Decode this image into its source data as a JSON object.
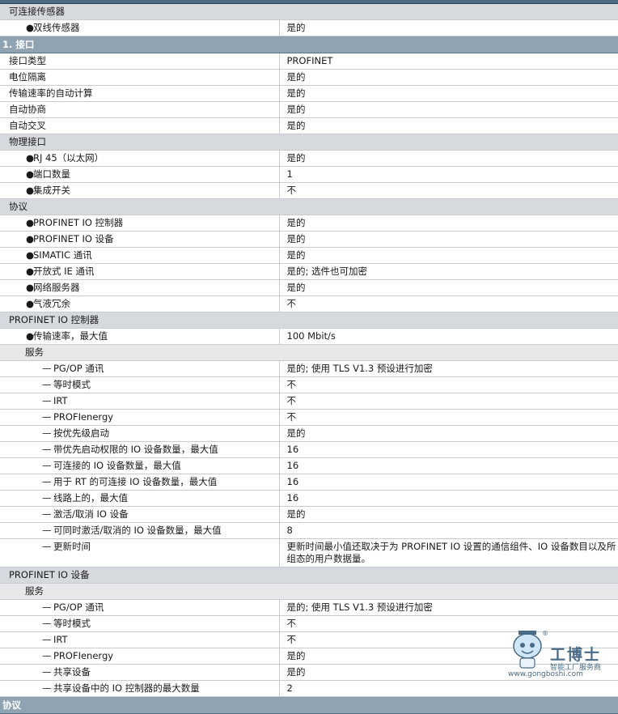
{
  "rows": [
    {
      "kind": "grp",
      "label": "可连接传感器",
      "value": ""
    },
    {
      "kind": "row",
      "level": 1,
      "marker": "bullet",
      "label": "双线传感器",
      "value": "是的"
    },
    {
      "kind": "sec",
      "label": "1. 接口"
    },
    {
      "kind": "row",
      "level": 0,
      "marker": "",
      "label": "接口类型",
      "value": "PROFINET"
    },
    {
      "kind": "row",
      "level": 0,
      "marker": "",
      "label": "电位隔离",
      "value": "是的"
    },
    {
      "kind": "row",
      "level": 0,
      "marker": "",
      "label": "传输速率的自动计算",
      "value": "是的"
    },
    {
      "kind": "row",
      "level": 0,
      "marker": "",
      "label": "自动协商",
      "value": "是的"
    },
    {
      "kind": "row",
      "level": 0,
      "marker": "",
      "label": "自动交叉",
      "value": "是的"
    },
    {
      "kind": "grp",
      "label": "物理接口",
      "value": ""
    },
    {
      "kind": "row",
      "level": 1,
      "marker": "bullet",
      "label": "RJ 45（以太网）",
      "value": "是的"
    },
    {
      "kind": "row",
      "level": 1,
      "marker": "bullet",
      "label": "端口数量",
      "value": "1"
    },
    {
      "kind": "row",
      "level": 1,
      "marker": "bullet",
      "label": "集成开关",
      "value": "不"
    },
    {
      "kind": "grp",
      "label": "协议",
      "value": ""
    },
    {
      "kind": "row",
      "level": 1,
      "marker": "bullet",
      "label": "PROFINET IO 控制器",
      "value": "是的"
    },
    {
      "kind": "row",
      "level": 1,
      "marker": "bullet",
      "label": "PROFINET IO 设备",
      "value": "是的"
    },
    {
      "kind": "row",
      "level": 1,
      "marker": "bullet",
      "label": "SIMATIC 通讯",
      "value": "是的"
    },
    {
      "kind": "row",
      "level": 1,
      "marker": "bullet",
      "label": "开放式 IE 通讯",
      "value": "是的; 选件也可加密"
    },
    {
      "kind": "row",
      "level": 1,
      "marker": "bullet",
      "label": "网络服务器",
      "value": "是的"
    },
    {
      "kind": "row",
      "level": 1,
      "marker": "bullet",
      "label": "气液冗余",
      "value": "不"
    },
    {
      "kind": "grp",
      "label": "PROFINET IO 控制器",
      "value": ""
    },
    {
      "kind": "row",
      "level": 1,
      "marker": "bullet",
      "label": "传输速率，最大值",
      "value": "100 Mbit/s"
    },
    {
      "kind": "sub",
      "label": "服务"
    },
    {
      "kind": "row",
      "level": 2,
      "marker": "dash",
      "label": "PG/OP 通讯",
      "value": "是的; 使用 TLS V1.3 预设进行加密"
    },
    {
      "kind": "row",
      "level": 2,
      "marker": "dash",
      "label": "等时模式",
      "value": "不"
    },
    {
      "kind": "row",
      "level": 2,
      "marker": "dash",
      "label": "IRT",
      "value": "不"
    },
    {
      "kind": "row",
      "level": 2,
      "marker": "dash",
      "label": "PROFIenergy",
      "value": "不"
    },
    {
      "kind": "row",
      "level": 2,
      "marker": "dash",
      "label": "按优先级启动",
      "value": "是的"
    },
    {
      "kind": "row",
      "level": 2,
      "marker": "dash",
      "label": "带优先启动权限的 IO 设备数量，最大值",
      "value": "16"
    },
    {
      "kind": "row",
      "level": 2,
      "marker": "dash",
      "label": "可连接的 IO 设备数量，最大值",
      "value": "16"
    },
    {
      "kind": "row",
      "level": 2,
      "marker": "dash",
      "label": "用于 RT 的可连接 IO 设备数量，最大值",
      "value": "16"
    },
    {
      "kind": "row",
      "level": 2,
      "marker": "dash",
      "label": "线路上的，最大值",
      "value": "16"
    },
    {
      "kind": "row",
      "level": 2,
      "marker": "dash",
      "label": "激活/取消 IO 设备",
      "value": "是的"
    },
    {
      "kind": "row",
      "level": 2,
      "marker": "dash",
      "label": "可同时激活/取消的 IO 设备数量，最大值",
      "value": "8"
    },
    {
      "kind": "row",
      "level": 2,
      "marker": "dash",
      "label": "更新时间",
      "value": "更新时间最小值还取决于为 PROFINET IO 设置的通信组件、IO 设备数目以及所组态的用户数据量。",
      "multi": true
    },
    {
      "kind": "grp",
      "label": "PROFINET IO 设备",
      "value": ""
    },
    {
      "kind": "sub",
      "label": "服务"
    },
    {
      "kind": "row",
      "level": 2,
      "marker": "dash",
      "label": "PG/OP 通讯",
      "value": "是的; 使用 TLS V1.3 预设进行加密"
    },
    {
      "kind": "row",
      "level": 2,
      "marker": "dash",
      "label": "等时模式",
      "value": "不"
    },
    {
      "kind": "row",
      "level": 2,
      "marker": "dash",
      "label": "IRT",
      "value": "不"
    },
    {
      "kind": "row",
      "level": 2,
      "marker": "dash",
      "label": "PROFIenergy",
      "value": "是的"
    },
    {
      "kind": "row",
      "level": 2,
      "marker": "dash",
      "label": "共享设备",
      "value": "是的"
    },
    {
      "kind": "row",
      "level": 2,
      "marker": "dash",
      "label": "共享设备中的 IO 控制器的最大数量",
      "value": "2"
    },
    {
      "kind": "sec",
      "label": "协议"
    }
  ],
  "markers": {
    "bullet": "●",
    "dash": "—"
  },
  "watermark": {
    "title": "工博士",
    "subtitle": "智能工厂服务商",
    "url": "www.gongboshi.com",
    "icon": "robot-mascot-icon",
    "registered": "®"
  },
  "colors": {
    "section": "#8fa3b3",
    "group": "#d6dade",
    "sub": "#e6e8ea",
    "accent": "#4a6b86"
  }
}
